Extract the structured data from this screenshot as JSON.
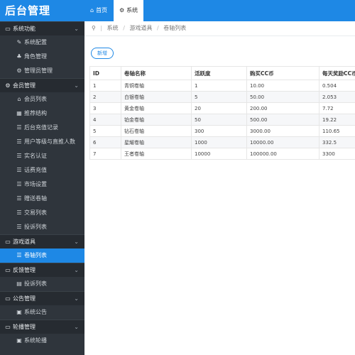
{
  "app": {
    "title": "后台管理"
  },
  "tabs": [
    {
      "icon": "home-icon",
      "label": "首页",
      "active": false
    },
    {
      "icon": "gear-icon",
      "label": "系统",
      "active": true
    }
  ],
  "breadcrumb": [
    "系统",
    "游戏道具",
    "卷轴列表"
  ],
  "sidebar": {
    "groups": [
      {
        "icon": "folder-icon",
        "label": "系统功能",
        "items": [
          {
            "icon": "wrench-icon",
            "label": "系统配置",
            "active": false
          },
          {
            "icon": "users-icon",
            "label": "角色管理",
            "active": false
          },
          {
            "icon": "gear-icon",
            "label": "管理员管理",
            "active": false
          }
        ]
      },
      {
        "icon": "gear-icon",
        "label": "会员管理",
        "items": [
          {
            "icon": "lock-icon",
            "label": "会员列表",
            "active": false
          },
          {
            "icon": "grid-icon",
            "label": "推荐结构",
            "active": false
          },
          {
            "icon": "list-icon",
            "label": "后台充值记录",
            "active": false
          },
          {
            "icon": "list-icon",
            "label": "用户等级与直推人数",
            "active": false
          },
          {
            "icon": "list-icon",
            "label": "实名认证",
            "active": false
          },
          {
            "icon": "list-icon",
            "label": "话费充值",
            "active": false
          },
          {
            "icon": "list-icon",
            "label": "市场设置",
            "active": false
          },
          {
            "icon": "list-icon",
            "label": "赠送卷轴",
            "active": false
          },
          {
            "icon": "list-icon",
            "label": "交易列表",
            "active": false
          },
          {
            "icon": "list-icon",
            "label": "投诉列表",
            "active": false
          }
        ]
      },
      {
        "icon": "folder-icon",
        "label": "游戏道具",
        "items": [
          {
            "icon": "list-icon",
            "label": "卷轴列表",
            "active": true
          }
        ]
      },
      {
        "icon": "folder-icon",
        "label": "反馈管理",
        "items": [
          {
            "icon": "document-icon",
            "label": "投诉列表",
            "active": false
          }
        ]
      },
      {
        "icon": "folder-icon",
        "label": "公告管理",
        "items": [
          {
            "icon": "image-icon",
            "label": "系统公告",
            "active": false
          }
        ]
      },
      {
        "icon": "folder-icon",
        "label": "轮播管理",
        "items": [
          {
            "icon": "image-icon",
            "label": "系统轮播",
            "active": false
          }
        ]
      }
    ]
  },
  "toolbar": {
    "add_label": "新增"
  },
  "table": {
    "columns": [
      "ID",
      "卷轴名称",
      "活跃度",
      "购买CC币",
      "每天奖励CC币"
    ],
    "rows": [
      [
        "1",
        "青铜卷轴",
        "1",
        "10.00",
        "0.504"
      ],
      [
        "2",
        "白银卷轴",
        "5",
        "50.00",
        "2.053"
      ],
      [
        "3",
        "黄金卷轴",
        "20",
        "200.00",
        "7.72"
      ],
      [
        "4",
        "铂金卷轴",
        "50",
        "500.00",
        "19.22"
      ],
      [
        "5",
        "钻石卷轴",
        "300",
        "3000.00",
        "110.65"
      ],
      [
        "6",
        "星耀卷轴",
        "1000",
        "10000.00",
        "332.5"
      ],
      [
        "7",
        "王者卷轴",
        "10000",
        "100000.00",
        "3300"
      ]
    ]
  },
  "colors": {
    "accent": "#1e88e5",
    "sidebar_bg": "#2f353c",
    "sidebar_group_bg": "#262b31"
  }
}
